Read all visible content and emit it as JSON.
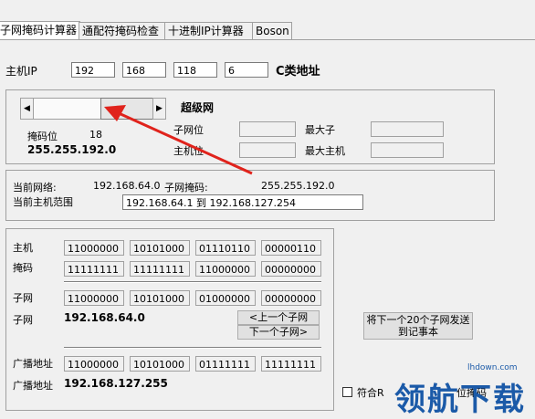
{
  "tabs": [
    "子网掩码计算器",
    "通配符掩码检查",
    "十进制IP计算器",
    "Boson"
  ],
  "host_ip": {
    "label": "主机IP",
    "octets": [
      "192",
      "168",
      "118",
      "6"
    ],
    "class_label": "C类地址"
  },
  "slider": {
    "left_arrow": "◀",
    "right_arrow": "▶",
    "supernet_label": "超级网",
    "mask_bits_label": "掩码位",
    "mask_bits_value": "18",
    "mask_value": "255.255.192.0",
    "subnet_bits_label": "子网位",
    "max_subnets_label": "最大子",
    "host_bits_label": "主机位",
    "max_hosts_label": "最大主机",
    "subnet_bits_value": "",
    "max_subnets_value": "",
    "host_bits_value": "",
    "max_hosts_value": ""
  },
  "network": {
    "current_network_label": "当前网络:",
    "current_network_value": "192.168.64.0",
    "subnet_mask_label": "子网掩码:",
    "subnet_mask_value": "255.255.192.0",
    "host_range_label": "当前主机范围",
    "host_range_value": "192.168.64.1 到  192.168.127.254"
  },
  "binary": {
    "host_label": "主机",
    "host_bits": [
      "11000000",
      "10101000",
      "01110110",
      "00000110"
    ],
    "mask_label": "掩码",
    "mask_bits": [
      "11111111",
      "11111111",
      "11000000",
      "00000000"
    ],
    "subnet_label": "子网",
    "subnet_bits": [
      "11000000",
      "10101000",
      "01000000",
      "00000000"
    ],
    "subnet_label2": "子网",
    "subnet_value": "192.168.64.0",
    "prev_subnet_button": "<上一个子网",
    "next_subnet_button": "下一个子网>",
    "broadcast_label": "广播地址",
    "broadcast_bits": [
      "11000000",
      "10101000",
      "01111111",
      "11111111"
    ],
    "broadcast_label2": "广播地址",
    "broadcast_value": "192.168.127.255"
  },
  "send_button": "将下一个20个子网发送到记事本",
  "checkbox_label": "符合R",
  "checkbox_label_tail": "位掩码",
  "watermark": {
    "brand": "领航下载",
    "url": "lhdown.com"
  }
}
